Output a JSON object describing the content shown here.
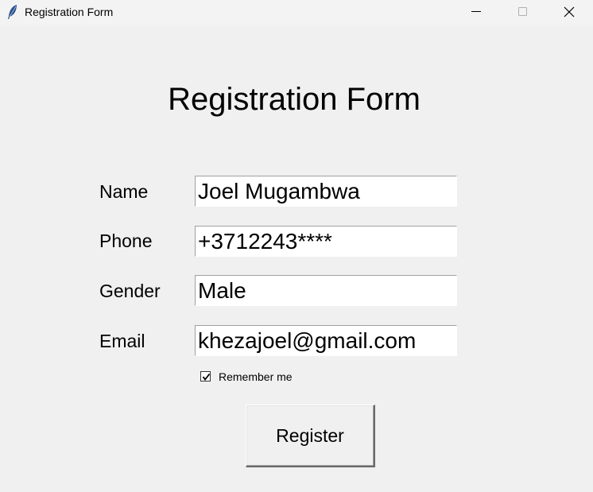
{
  "window": {
    "title": "Registration Form",
    "icon": "feather-icon",
    "controls": [
      "minimize-icon",
      "maximize-icon",
      "close-icon"
    ]
  },
  "form": {
    "heading": "Registration Form",
    "fields": [
      {
        "label": "Name",
        "value": "Joel Mugambwa"
      },
      {
        "label": "Phone",
        "value": "+3712243****"
      },
      {
        "label": "Gender",
        "value": "Male"
      },
      {
        "label": "Email",
        "value": "khezajoel@gmail.com"
      }
    ],
    "remember": {
      "label": "Remember me",
      "checked": true
    },
    "submit_label": "Register"
  }
}
